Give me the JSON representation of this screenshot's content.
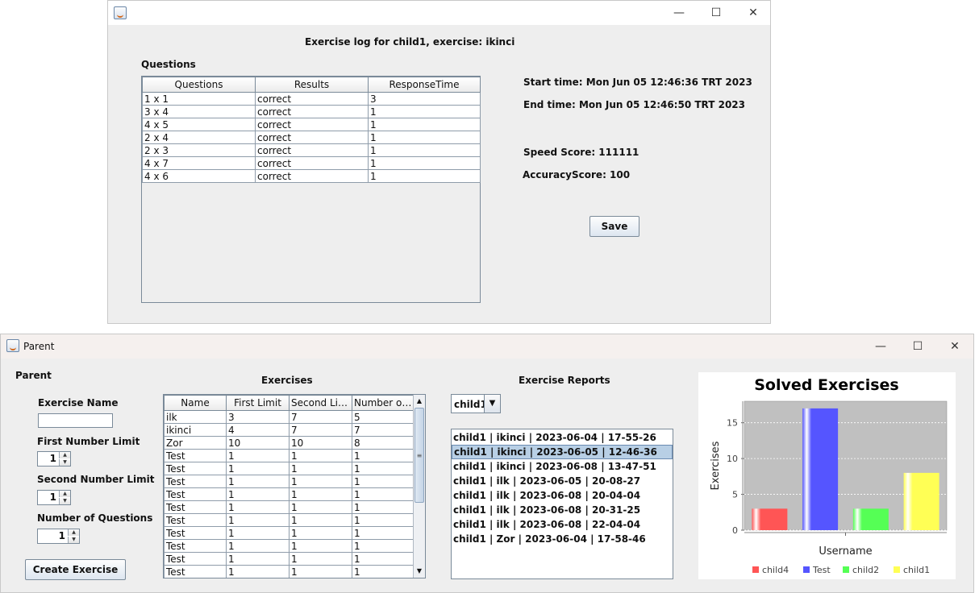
{
  "log_window": {
    "title": "",
    "heading": "Exercise log for child1, exercise: ikinci",
    "questions_label": "Questions",
    "table": {
      "columns": [
        "Questions",
        "Results",
        "ResponseTime"
      ],
      "rows": [
        [
          "1 x 1",
          "correct",
          "3"
        ],
        [
          "3 x 4",
          "correct",
          "1"
        ],
        [
          "4 x 5",
          "correct",
          "1"
        ],
        [
          "2 x 4",
          "correct",
          "1"
        ],
        [
          "2 x 3",
          "correct",
          "1"
        ],
        [
          "4 x 7",
          "correct",
          "1"
        ],
        [
          "4 x 6",
          "correct",
          "1"
        ]
      ]
    },
    "start_time": "Start time: Mon Jun 05 12:46:36 TRT 2023",
    "end_time": "End time: Mon Jun 05 12:46:50 TRT 2023",
    "speed_score": "Speed Score: 111111",
    "accuracy_score": "AccuracyScore: 100",
    "save_label": "Save"
  },
  "parent_window": {
    "title": "Parent",
    "section_label": "Parent",
    "exercise_name_label": "Exercise Name",
    "exercise_name_value": "",
    "first_limit_label": "First Number Limit",
    "first_limit_value": "1",
    "second_limit_label": "Second Number Limit",
    "second_limit_value": "1",
    "num_questions_label": "Number of Questions",
    "num_questions_value": "1",
    "create_label": "Create Exercise",
    "exercises_label": "Exercises",
    "exercises_table": {
      "columns": [
        "Name",
        "First Limit",
        "Second Limit",
        "Number of ..."
      ],
      "rows": [
        [
          "ilk",
          "3",
          "7",
          "5"
        ],
        [
          "ikinci",
          "4",
          "7",
          "7"
        ],
        [
          "Zor",
          "10",
          "10",
          "8"
        ],
        [
          "Test",
          "1",
          "1",
          "1"
        ],
        [
          "Test",
          "1",
          "1",
          "1"
        ],
        [
          "Test",
          "1",
          "1",
          "1"
        ],
        [
          "Test",
          "1",
          "1",
          "1"
        ],
        [
          "Test",
          "1",
          "1",
          "1"
        ],
        [
          "Test",
          "1",
          "1",
          "1"
        ],
        [
          "Test",
          "1",
          "1",
          "1"
        ],
        [
          "Test",
          "1",
          "1",
          "1"
        ],
        [
          "Test",
          "1",
          "1",
          "1"
        ],
        [
          "Test",
          "1",
          "1",
          "1"
        ]
      ]
    },
    "reports_label": "Exercise Reports",
    "child_select": "child1",
    "reports": [
      "child1 | ikinci | 2023-06-04 | 17-55-26",
      "child1 | ikinci | 2023-06-05 | 12-46-36",
      "child1 | ikinci | 2023-06-08 | 13-47-51",
      "child1 | ilk | 2023-06-05 | 20-08-27",
      "child1 | ilk | 2023-06-08 | 20-04-04",
      "child1 | ilk | 2023-06-08 | 20-31-25",
      "child1 | ilk | 2023-06-08 | 22-04-04",
      "child1 | Zor | 2023-06-04 | 17-58-46"
    ],
    "selected_report_index": 1
  },
  "chart_data": {
    "type": "bar",
    "title": "Solved Exercises",
    "xlabel": "Username",
    "ylabel": "Exercises",
    "ylim": [
      0,
      18
    ],
    "yticks": [
      0,
      5,
      10,
      15
    ],
    "grid": true,
    "legend_position": "bottom",
    "series": [
      {
        "name": "child4",
        "value": 3,
        "color": "#ff5555"
      },
      {
        "name": "Test",
        "value": 17,
        "color": "#5555ff"
      },
      {
        "name": "child2",
        "value": 3,
        "color": "#55ff55"
      },
      {
        "name": "child1",
        "value": 8,
        "color": "#ffff55"
      }
    ]
  }
}
